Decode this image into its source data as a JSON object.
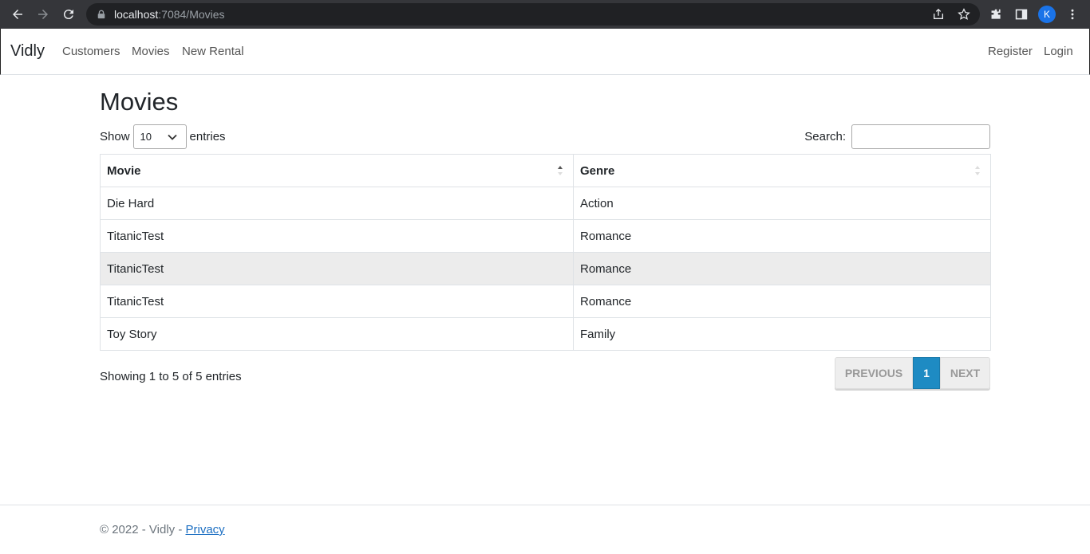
{
  "browser": {
    "url_host": "localhost",
    "url_path": ":7084/Movies",
    "profile_initial": "K"
  },
  "navbar": {
    "brand": "Vidly",
    "links": [
      "Customers",
      "Movies",
      "New Rental"
    ],
    "register": "Register",
    "login": "Login"
  },
  "page": {
    "title": "Movies",
    "show_label": "Show",
    "entries_label": "entries",
    "length_value": "10",
    "search_label": "Search:",
    "search_value": ""
  },
  "table": {
    "headers": [
      "Movie",
      "Genre"
    ],
    "rows": [
      [
        "Die Hard",
        "Action"
      ],
      [
        "TitanicTest",
        "Romance"
      ],
      [
        "TitanicTest",
        "Romance"
      ],
      [
        "TitanicTest",
        "Romance"
      ],
      [
        "Toy Story",
        "Family"
      ]
    ]
  },
  "info": "Showing 1 to 5 of 5 entries",
  "pager": {
    "previous": "PREVIOUS",
    "current": "1",
    "next": "NEXT"
  },
  "footer": {
    "text": "© 2022 - Vidly - ",
    "privacy": "Privacy"
  }
}
